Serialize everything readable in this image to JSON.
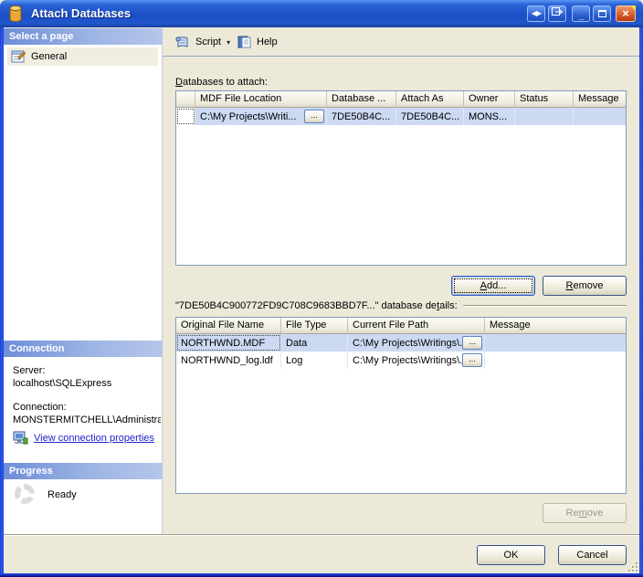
{
  "window": {
    "title": "Attach Databases"
  },
  "toolbar": {
    "script_label": "Script",
    "help_label": "Help",
    "dropdown_glyph": "▾"
  },
  "titlebar_glyphs": {
    "nav_arrows": "◀▶",
    "minimize": "_",
    "close": "×"
  },
  "sidebar": {
    "select_page": {
      "header": "Select a page",
      "items": [
        {
          "label": "General"
        }
      ]
    },
    "connection": {
      "header": "Connection",
      "server_label": "Server:",
      "server_value": "localhost\\SQLExpress",
      "connection_label": "Connection:",
      "connection_value": "MONSTERMITCHELL\\Administra",
      "link_label": "View connection properties"
    },
    "progress": {
      "header": "Progress",
      "status": "Ready"
    }
  },
  "main": {
    "attach_label": {
      "pre": "",
      "mn": "D",
      "post": "atabases to attach:"
    },
    "grid1": {
      "headers": [
        "",
        "MDF File Location",
        "Database ...",
        "Attach As",
        "Owner",
        "Status",
        "Message"
      ],
      "rows": [
        {
          "mdf": "C:\\My Projects\\Writi...",
          "database": "7DE50B4C...",
          "attach_as": "7DE50B4C...",
          "owner": "MONS...",
          "status": "",
          "message": ""
        }
      ]
    },
    "browse_label": "...",
    "add_button": {
      "pre": "",
      "mn": "A",
      "post": "dd..."
    },
    "remove_button": {
      "pre": "",
      "mn": "R",
      "post": "emove"
    },
    "details_label": {
      "pre": "\"7DE50B4C900772FD9C708C9683BBD7F...\" database de",
      "mn": "t",
      "post": "ails:"
    },
    "grid2": {
      "headers": [
        "Original File Name",
        "File Type",
        "Current File Path",
        "Message"
      ],
      "rows": [
        {
          "name": "NORTHWND.MDF",
          "type": "Data",
          "path": "C:\\My Projects\\Writings\\...",
          "message": ""
        },
        {
          "name": "NORTHWND_log.ldf",
          "type": "Log",
          "path": "C:\\My Projects\\Writings\\...",
          "message": ""
        }
      ]
    },
    "remove2_button": {
      "pre": "Re",
      "mn": "m",
      "post": "ove"
    },
    "ok_label": "OK",
    "cancel_label": "Cancel"
  },
  "colors": {
    "titlebar": "#1e54c8",
    "selection": "#cbd9f2",
    "link": "#2222cc",
    "panel": "#ece9d8"
  }
}
